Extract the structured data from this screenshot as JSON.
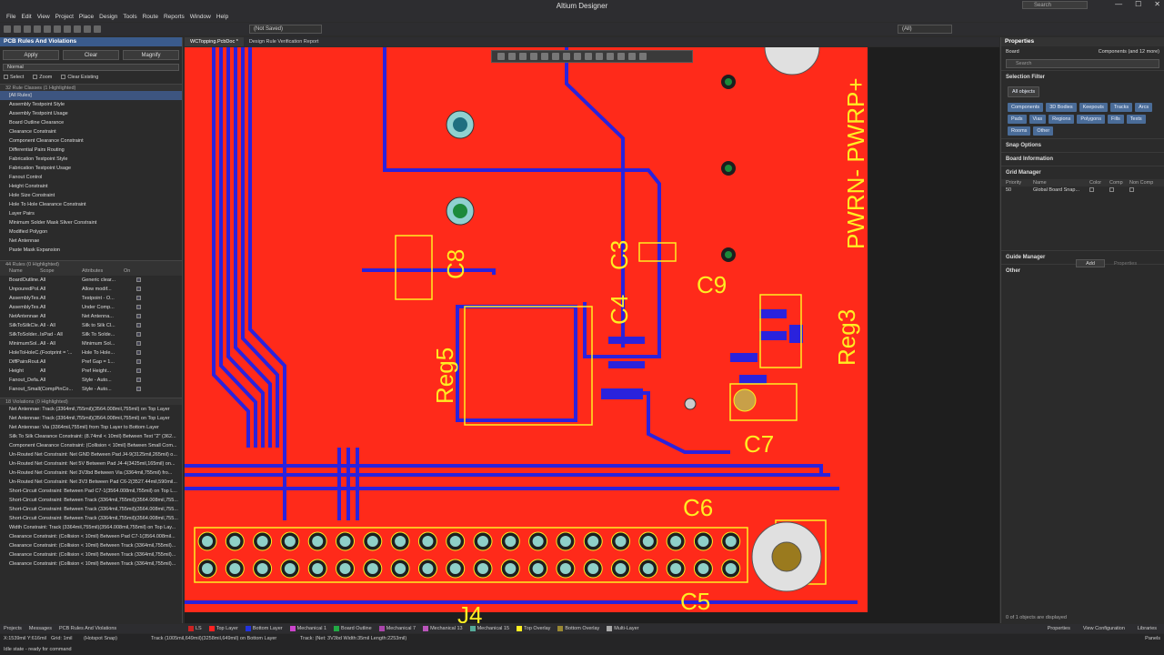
{
  "app": {
    "title": "Altium Designer",
    "search_placeholder": "Search"
  },
  "menu": [
    "File",
    "Edit",
    "View",
    "Project",
    "Place",
    "Design",
    "Tools",
    "Route",
    "Reports",
    "Window",
    "Help"
  ],
  "toolbar": {
    "save_state": "(Not Saved)",
    "filter": "(All)"
  },
  "left_panel": {
    "title": "PCB Rules And Violations",
    "buttons": {
      "apply": "Apply",
      "clear": "Clear",
      "magnify": "Magnify"
    },
    "mode": "Normal",
    "checks": {
      "select": "Select",
      "zoom": "Zoom",
      "clear_existing": "Clear Existing"
    },
    "rule_classes_header": "32 Rule Classes (1 Highlighted)",
    "rule_classes": [
      "[All Rules]",
      "Assembly Testpoint Style",
      "Assembly Testpoint Usage",
      "Board Outline Clearance",
      "Clearance Constraint",
      "Component Clearance Constraint",
      "Differential Pairs Routing",
      "Fabrication Testpoint Style",
      "Fabrication Testpoint Usage",
      "Fanout Control",
      "Height Constraint",
      "Hole Size Constraint",
      "Hole To Hole Clearance Constraint",
      "Layer Pairs",
      "Minimum Solder Mask Sliver Constraint",
      "Modified Polygon",
      "Net Antennae",
      "Paste Mask Expansion"
    ],
    "rules_header": "44 Rules (0 Highlighted)",
    "rules_cols": [
      "Name",
      "Scope",
      "Attributes",
      "On"
    ],
    "rules": [
      [
        "BoardOutline...",
        "All",
        "Generic clear..."
      ],
      [
        "UnpouredPol...",
        "All",
        "Allow modif..."
      ],
      [
        "AssemblyTes...",
        "All",
        "Testpoint - O..."
      ],
      [
        "AssemblyTes...",
        "All",
        "Under Comp..."
      ],
      [
        "NetAntennae",
        "All",
        "Net Antenna..."
      ],
      [
        "SilkToSilkCle...",
        "All - All",
        "Silk to Silk Cl..."
      ],
      [
        "SilkToSolder...",
        "IsPad - All",
        "Silk To Solde..."
      ],
      [
        "MinimumSol...",
        "All - All",
        "Minimum Sol..."
      ],
      [
        "HoleToHoleC...",
        "(Footprint = '...",
        "Hole To Hole..."
      ],
      [
        "DiffPairsRout...",
        "All",
        "Pref Gap = 1..."
      ],
      [
        "Height",
        "All",
        "Pref Height..."
      ],
      [
        "Fanout_Defa...",
        "All",
        "Style - Auto..."
      ],
      [
        "Fanout_Small",
        "(CompPinCo...",
        "Style - Auto..."
      ]
    ],
    "violations_header": "18 Violations (0 Highlighted)",
    "violations": [
      "Net Antennae: Track (3364mil,755mil)(3564.008mil,755mil) on Top Layer",
      "Net Antennae: Track (3364mil,755mil)(3564.008mil,755mil) on Top Layer",
      "Net Antennae: Via (3364mil,755mil) from Top Layer to Bottom Layer",
      "Silk To Silk Clearance Constraint: (8.74mil < 10mil) Between Text \"2\" (362...",
      "Component Clearance Constraint: (Collision < 10mil) Between Small Com...",
      "Un-Routed Net Constraint: Net GND Between Pad J4-9(3125mil,265mil) o...",
      "Un-Routed Net Constraint: Net 5V Between Pad J4-4(3425mil,165mil) on...",
      "Un-Routed Net Constraint: Net 3V3bd Between Via (3364mil,755mil) fro...",
      "Un-Routed Net Constraint: Net 3V3 Between Pad C6-2(3527.44mil,590mil...",
      "Short-Circuit Constraint: Between Pad C7-1(3564.008mil,755mil) on Top L...",
      "Short-Circuit Constraint: Between Track (3364mil,755mil)(3564.008mil,755...",
      "Short-Circuit Constraint: Between Track (3364mil,755mil)(3564.008mil,755...",
      "Short-Circuit Constraint: Between Track (3364mil,755mil)(3564.008mil,755...",
      "Width Constraint: Track (3364mil,755mil)(3564.008mil,755mil) on Top Lay...",
      "Clearance Constraint: (Collision < 10mil) Between Pad C7-1(3564.008mil...",
      "Clearance Constraint: (Collision < 10mil) Between Track (3364mil,755mil)...",
      "Clearance Constraint: (Collision < 10mil) Between Track (3364mil,755mil)...",
      "Clearance Constraint: (Collision < 10mil) Between Track (3364mil,755mil)..."
    ]
  },
  "doc_tabs": [
    "WCTopping.PcbDoc *",
    "Design Rule Verification Report"
  ],
  "pcb": {
    "labels": {
      "j4": "J4",
      "c3": "C3",
      "c4": "C4",
      "c5": "C5",
      "c6": "C6",
      "c7": "C7",
      "c8": "C8",
      "c9": "C9",
      "reg3": "Reg3",
      "reg5": "Reg5",
      "pwr": "PWRN- PWRP+"
    }
  },
  "right_panel": {
    "title": "Properties",
    "board": "Board",
    "components": "Components (and 12 more)",
    "search_placeholder": "Search",
    "selection_filter": "Selection Filter",
    "all_objects": "All objects",
    "chips": [
      "Components",
      "3D Bodies",
      "Keepouts",
      "Tracks",
      "Arcs",
      "Pads",
      "Vias",
      "Regions",
      "Polygons",
      "Fills",
      "Texts",
      "Rooms",
      "Other"
    ],
    "snap_options": "Snap Options",
    "board_information": "Board Information",
    "grid_manager": "Grid Manager",
    "grid_cols": [
      "Priority",
      "Name",
      "Color",
      "Comp",
      "Non Comp"
    ],
    "grid_row": {
      "priority": "50",
      "name": "Global Board Snap..."
    },
    "add": "Add",
    "properties_btn": "Properties",
    "guide_manager": "Guide Manager",
    "other": "Other",
    "footer": "0 of 1 objects are displayed"
  },
  "status": {
    "panel_tabs": [
      "Projects",
      "Messages",
      "PCB Rules And Violations"
    ],
    "layers": [
      {
        "name": "LS",
        "color": "#cc2222"
      },
      {
        "name": "Top Layer",
        "color": "#ff2222"
      },
      {
        "name": "Bottom Layer",
        "color": "#2233dd"
      },
      {
        "name": "Mechanical 1",
        "color": "#cc44cc"
      },
      {
        "name": "Board Outline",
        "color": "#22aa44"
      },
      {
        "name": "Mechanical 7",
        "color": "#aa44aa"
      },
      {
        "name": "Mechanical 13",
        "color": "#bb55bb"
      },
      {
        "name": "Mechanical 15",
        "color": "#55aa99"
      },
      {
        "name": "Top Overlay",
        "color": "#ffee22"
      },
      {
        "name": "Bottom Overlay",
        "color": "#998833"
      },
      {
        "name": "Multi-Layer",
        "color": "#aaaaaa"
      }
    ],
    "right_tabs": [
      "Properties",
      "View Configuration",
      "Libraries"
    ],
    "coords": "X:1539mil Y:616mil",
    "grid": "Grid: 1mil",
    "snap": "(Hotspot Snap)",
    "track_info": "Track (1005mil,649mil)(3258mil,649mil) on Bottom Layer",
    "track_net": "Track: (Net: 3V3bd Width:35mil Length:2253mil)",
    "idle": "Idle state - ready for command",
    "panels": "Panels"
  }
}
